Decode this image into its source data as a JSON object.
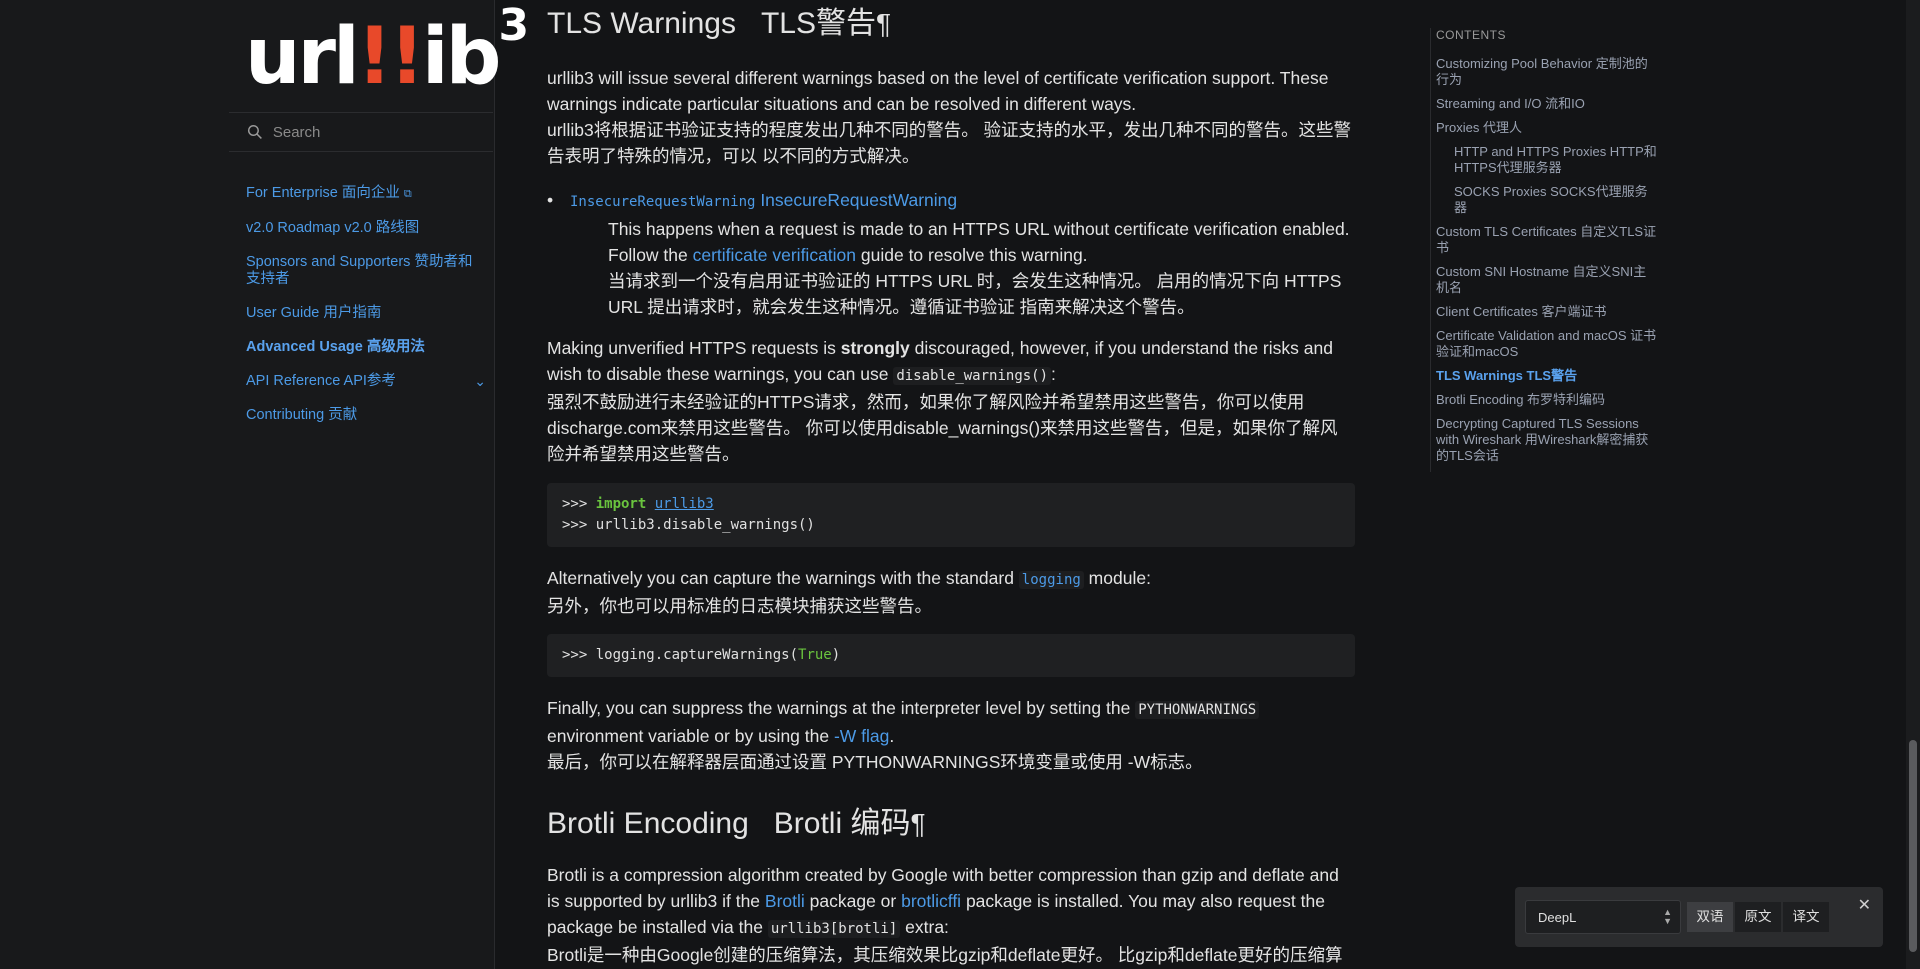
{
  "sidebar": {
    "logo_main": "url",
    "logo_bang": "!!",
    "logo_tail": "ib",
    "logo_sup": "3",
    "search_placeholder": "Search",
    "items": [
      {
        "label": "For Enterprise 面向企业"
      },
      {
        "label": "v2.0 Roadmap v2.0 路线图"
      },
      {
        "label": "Sponsors and Supporters 赞助者和支持者"
      },
      {
        "label": "User Guide 用户指南"
      },
      {
        "label": "Advanced Usage 高级用法"
      },
      {
        "label": "API Reference API参考"
      },
      {
        "label": "Contributing 贡献"
      }
    ]
  },
  "main": {
    "tls_heading": "TLS Warnings   TLS警告",
    "pilcrow": "¶",
    "p1_en": "urllib3 will issue several different warnings based on the level of certificate verification support. These warnings indicate particular situations and can be resolved in different ways.",
    "p1_zh": "urllib3将根据证书验证支持的程度发出几种不同的警告。 验证支持的水平，发出几种不同的警告。这些警告表明了特殊的情况，可以 以不同的方式解决。",
    "warning_code": "InsecureRequestWarning",
    "warning_link": "InsecureRequestWarning",
    "warning_desc_1": "This happens when a request is made to an HTTPS URL without certificate verification enabled. Follow the ",
    "warning_desc_link": "certificate verification",
    "warning_desc_2": " guide to resolve this warning.",
    "warning_desc_zh": "当请求到一个没有启用证书验证的 HTTPS URL 时，会发生这种情况。 启用的情况下向 HTTPS URL 提出请求时，就会发生这种情况。遵循证书验证 指南来解决这个警告。",
    "p2_a": "Making unverified HTTPS requests is ",
    "p2_strong": "strongly",
    "p2_b": " discouraged, however, if you understand the risks and wish to disable these warnings, you can use ",
    "p2_code": "disable_warnings()",
    "p2_c": ":",
    "p2_zh": "强烈不鼓励进行未经验证的HTTPS请求，然而，如果你了解风险并希望禁用这些警告，你可以使用discharge.com来禁用这些警告。 你可以使用disable_warnings()来禁用这些警告，但是，如果你了解风险并希望禁用这些警告。",
    "code1_prompt1": ">>> ",
    "code1_import": "import",
    "code1_module": "urllib3",
    "code1_line2": ">>> urllib3.disable_warnings()",
    "p3_a": "Alternatively you can capture the warnings with the standard ",
    "p3_code": "logging",
    "p3_b": " module:",
    "p3_zh": "另外，你也可以用标准的日志模块捕获这些警告。",
    "code2_a": ">>> logging.captureWarnings(",
    "code2_true": "True",
    "code2_b": ")",
    "p4_a": "Finally, you can suppress the warnings at the interpreter level by setting the ",
    "p4_code": "PYTHONWARNINGS",
    "p4_b": " environment variable or by using the ",
    "p4_link": "-W flag",
    "p4_c": ".",
    "p4_zh": "最后，你可以在解释器层面通过设置 PYTHONWARNINGS环境变量或使用 -W标志。",
    "brotli_heading": "Brotli Encoding   Brotli 编码",
    "p5_a": "Brotli is a compression algorithm created by Google with better compression than gzip and deflate and is supported by urllib3 if the ",
    "p5_link1": "Brotli",
    "p5_b": " package or ",
    "p5_link2": "brotlicffi",
    "p5_c": " package is installed. You may also request the package be installed via the ",
    "p5_code": "urllib3[brotli]",
    "p5_d": " extra:",
    "p5_zh": "Brotli是一种由Google创建的压缩算法，其压缩效果比gzip和deflate更好。 比gzip和deflate更好的压缩算"
  },
  "toc": {
    "title": "CONTENTS",
    "items": [
      {
        "label": "Customizing Pool Behavior 定制池的行为"
      },
      {
        "label": "Streaming and I/O 流和IO"
      },
      {
        "label": "Proxies 代理人"
      },
      {
        "label": "HTTP and HTTPS Proxies HTTP和HTTPS代理服务器"
      },
      {
        "label": "SOCKS Proxies SOCKS代理服务器"
      },
      {
        "label": "Custom TLS Certificates 自定义TLS证书"
      },
      {
        "label": "Custom SNI Hostname 自定义SNI主机名"
      },
      {
        "label": "Client Certificates 客户端证书"
      },
      {
        "label": "Certificate Validation and macOS 证书验证和macOS"
      },
      {
        "label": "TLS Warnings TLS警告"
      },
      {
        "label": "Brotli Encoding 布罗特利编码"
      },
      {
        "label": "Decrypting Captured TLS Sessions with Wireshark 用Wireshark解密捕获的TLS会话"
      }
    ]
  },
  "translator": {
    "engine": "DeepL",
    "modes": [
      "双语",
      "原文",
      "译文"
    ],
    "close": "✕"
  }
}
